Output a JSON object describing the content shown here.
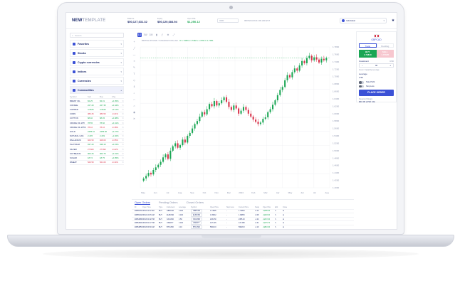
{
  "app": {
    "logo_bold": "NEW",
    "logo_light": "TEMPLATE"
  },
  "header": {
    "stats": [
      {
        "label": "Balance",
        "value": "$50,127,631.32"
      },
      {
        "label": "Equity",
        "value": "$50,120,684.94"
      },
      {
        "label": "Open P&L",
        "value": "$1,250.12"
      }
    ],
    "currency": "USD",
    "datetime": "08/15/24 09:41:03 AM EST",
    "account": "Individual"
  },
  "sidebar": {
    "search_placeholder": "Search",
    "sections": [
      "Favorites",
      "Stocks",
      "Crypto currencies",
      "Indices",
      "Currencies",
      "Commodities"
    ],
    "table_headers": [
      "Symbol",
      "Sell",
      "Buy",
      "Chg"
    ],
    "rows": [
      {
        "symbol": "BRENT OIL",
        "sell": "84.25",
        "buy": "84.31",
        "chg": "+0.35%",
        "down": false
      },
      {
        "symbol": "COFFEE",
        "sell": "227.20",
        "buy": "227.35",
        "chg": "+0.44%",
        "down": false
      },
      {
        "symbol": "COPPER",
        "sell": "4.0625",
        "buy": "4.0640",
        "chg": "+0.12%",
        "down": false
      },
      {
        "symbol": "CORN",
        "sell": "380.25",
        "buy": "380.50",
        "chg": "-0.21%",
        "down": true
      },
      {
        "symbol": "COTTON",
        "sell": "68.40",
        "buy": "68.45",
        "chg": "+0.08%",
        "down": false
      },
      {
        "symbol": "CRUDE OIL WTI",
        "sell": "78.55",
        "buy": "78.60",
        "chg": "+0.41%",
        "down": false
      },
      {
        "symbol": "CRUDE OIL WTI2",
        "sell": "78.10",
        "buy": "78.16",
        "chg": "-0.18%",
        "down": true
      },
      {
        "symbol": "GOLD",
        "sell": "2455.10",
        "buy": "2455.60",
        "chg": "+0.27%",
        "down": false
      },
      {
        "symbol": "NATURAL GAS",
        "sell": "2.245",
        "buy": "2.249",
        "chg": "+1.02%",
        "down": false
      },
      {
        "symbol": "PALLADIUM",
        "sell": "926.50",
        "buy": "928.00",
        "chg": "-0.35%",
        "down": true
      },
      {
        "symbol": "PLATINUM",
        "sell": "937.20",
        "buy": "938.10",
        "chg": "+0.15%",
        "down": false
      },
      {
        "symbol": "SILVER",
        "sell": "27.860",
        "buy": "27.890",
        "chg": "-0.22%",
        "down": true
      },
      {
        "symbol": "SOYBEANS",
        "sell": "960.25",
        "buy": "960.75",
        "chg": "+0.31%",
        "down": false
      },
      {
        "symbol": "SUGAR",
        "sell": "18.72",
        "buy": "18.75",
        "chg": "+0.05%",
        "down": false
      },
      {
        "symbol": "WHEAT",
        "sell": "520.50",
        "buy": "521.00",
        "chg": "-0.14%",
        "down": true
      }
    ]
  },
  "chart": {
    "toolbar": [
      "1D",
      "1W",
      "1M",
      "Candles",
      "Indicators",
      "Compare",
      "Fullscreen"
    ],
    "legend_symbol": "BRITISH POUND / CANADIAN DOLLAR",
    "legend_ohlc": "O 1.7468  H 1.7492  L 1.7453  C 1.7481",
    "x_ticks": [
      "May",
      "Jun",
      "Jul",
      "Aug",
      "Sep",
      "Oct",
      "Nov",
      "Dec",
      "2024",
      "Feb",
      "Mar",
      "Apr",
      "May",
      "Jun",
      "Jul",
      "Aug"
    ],
    "y_ticks": [
      "1.7800",
      "1.7600",
      "1.7400",
      "1.7200",
      "1.7000",
      "1.6800",
      "1.6600",
      "1.6400",
      "1.6200",
      "1.6000",
      "1.5800",
      "1.5600",
      "1.5400",
      "1.5200",
      "1.5000",
      "1.4800",
      "1.4600",
      "1.4400",
      "1.4200",
      "1.4000"
    ],
    "accent_color": "#3b51d6",
    "up_color": "#1aa654",
    "down_color": "#d8324a"
  },
  "chart_data": {
    "type": "candlestick",
    "y_min": 1.4,
    "y_max": 1.78,
    "closes": [
      1.425,
      1.432,
      1.44,
      1.436,
      1.448,
      1.455,
      1.462,
      1.47,
      1.482,
      1.49,
      1.478,
      1.5,
      1.512,
      1.52,
      1.508,
      1.515,
      1.53,
      1.522,
      1.54,
      1.548,
      1.56,
      1.572,
      1.58,
      1.592,
      1.604,
      1.598,
      1.612,
      1.626,
      1.62,
      1.634,
      1.622,
      1.628,
      1.636,
      1.644,
      1.632,
      1.618,
      1.61,
      1.622,
      1.614,
      1.6,
      1.608,
      1.618,
      1.61,
      1.6,
      1.592,
      1.584,
      1.578,
      1.572,
      1.576,
      1.586,
      1.59,
      1.604,
      1.612,
      1.624,
      1.636,
      1.65,
      1.664,
      1.672,
      1.69,
      1.704,
      1.698,
      1.712,
      1.722,
      1.716,
      1.73,
      1.742,
      1.736,
      1.75,
      1.756,
      1.744,
      1.752,
      1.746,
      1.738,
      1.748,
      1.744,
      1.75
    ]
  },
  "orders": {
    "tabs": [
      "Open Orders",
      "Pending Orders",
      "Closed Orders"
    ],
    "headers": [
      "ID",
      "Open Time",
      "Type",
      "Instrument",
      "Leverage",
      "Symbol",
      "Open Price",
      "Stop Loss",
      "Current Price",
      "Swap",
      "Open P&L",
      "Edit",
      "Close"
    ],
    "rows": [
      {
        "id": "#2865131",
        "time": "08/14 11:32 AM",
        "type": "BUY",
        "instr": "GBPCAD",
        "lev": "1:100",
        "sym": "GBPCAD",
        "open": "1.74625",
        "sl": "-",
        "cur": "1.74810",
        "swap": "-0.12",
        "pl": "+$185.00"
      },
      {
        "id": "#2865102",
        "time": "08/14 10:15 AM",
        "type": "BUY",
        "instr": "EURUSD",
        "lev": "1:100",
        "sym": "EURUSD",
        "open": "1.09612",
        "sl": "-",
        "cur": "1.09815",
        "swap": "-0.08",
        "pl": "+$203.00"
      },
      {
        "id": "#2864988",
        "time": "08/13 04:02 PM",
        "type": "BUY",
        "instr": "XAUUSD",
        "lev": "1:50",
        "sym": "XAUUSD",
        "open": "2431.50",
        "sl": "-",
        "cur": "2455.10",
        "swap": "-1.24",
        "pl": "+$472.00"
      },
      {
        "id": "#2864901",
        "time": "08/13 01:47 PM",
        "type": "BUY",
        "instr": "USDJPY",
        "lev": "1:100",
        "sym": "USDJPY",
        "open": "147.215",
        "sl": "-",
        "cur": "147.480",
        "swap": "-0.31",
        "pl": "+$179.70"
      },
      {
        "id": "#2864850",
        "time": "08/13 09:30 AM",
        "type": "BUY",
        "instr": "BTCUSD",
        "lev": "1:10",
        "sym": "BTCUSD",
        "open": "58210.0",
        "sl": "-",
        "cur": "59020.0",
        "swap": "-2.10",
        "pl": "+$810.00"
      }
    ]
  },
  "panel": {
    "symbol": "GBPCAD",
    "tabs": [
      "Trade",
      "Pending"
    ],
    "buy_label": "BUY",
    "buy_price": "1.74810",
    "sell_label": "SELL",
    "sell_price": "1.74625",
    "investment_label": "Investment",
    "investment_unit": "USD",
    "investment_value": "40",
    "note": "Invest = Quantity/Leverage",
    "leverage_label": "Leverage",
    "leverage_value": "1:50",
    "toggle1": "Take Profit",
    "toggle2": "Stop Loss",
    "place_order": "PLACE ORDER",
    "margin_label": "Required Margin",
    "margin_value": "$40.00 (USD 40)"
  }
}
